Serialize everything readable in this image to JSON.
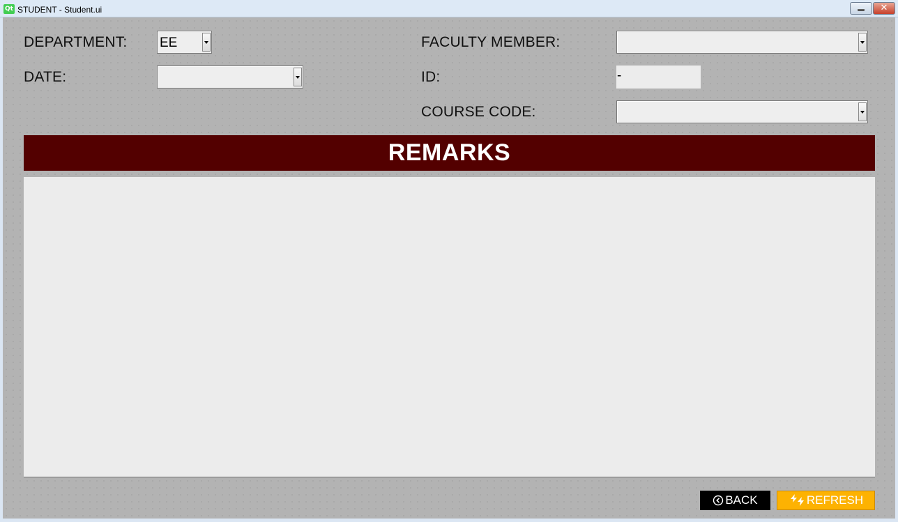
{
  "window": {
    "logo_text": "Qt",
    "title": "STUDENT - Student.ui",
    "close_glyph": "✕"
  },
  "form": {
    "department_label": "DEPARTMENT:",
    "department_value": "EE",
    "date_label": "DATE:",
    "date_value": "",
    "faculty_label": "FACULTY MEMBER:",
    "faculty_value": "",
    "id_label": "ID:",
    "id_value": "-",
    "course_label": "COURSE CODE:",
    "course_value": ""
  },
  "remarks": {
    "header": "REMARKS",
    "text": ""
  },
  "buttons": {
    "back_label": "BACK",
    "back_icon": "circle-chevron-left-icon",
    "refresh_label": "REFRESH",
    "refresh_icon": "refresh-bolt-icon"
  },
  "colors": {
    "header_bg": "#530000",
    "refresh_bg": "#fdb202",
    "back_bg": "#000000",
    "window_bg": "#b3b3b3"
  }
}
